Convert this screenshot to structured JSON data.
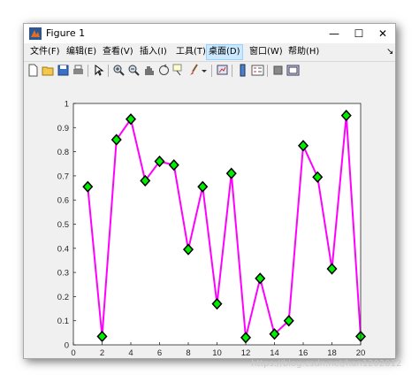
{
  "window": {
    "title": "Figure 1",
    "controls": {
      "minimize": "—",
      "maximize": "☐",
      "close": "✕"
    }
  },
  "menu": {
    "items": [
      {
        "label": "文件(F)"
      },
      {
        "label": "编辑(E)"
      },
      {
        "label": "查看(V)"
      },
      {
        "label": "插入(I)"
      },
      {
        "label": "工具(T)"
      },
      {
        "label": "桌面(D)"
      },
      {
        "label": "窗口(W)"
      },
      {
        "label": "帮助(H)"
      }
    ],
    "active_index": 5,
    "overflow": "↘"
  },
  "toolbar": {
    "icons": [
      "new-figure-icon",
      "open-file-icon",
      "save-icon",
      "print-icon",
      "pointer-icon",
      "zoom-in-icon",
      "zoom-out-icon",
      "pan-icon",
      "rotate-3d-icon",
      "data-cursor-icon",
      "brush-icon",
      "dropdown-arrow-icon",
      "link-plot-icon",
      "colorbar-icon",
      "legend-icon",
      "hide-plot-tools-icon",
      "show-plot-tools-icon"
    ]
  },
  "colors": {
    "line": "#ff00ff",
    "marker_fill": "#00ee00",
    "marker_edge": "#000000",
    "axes_bg": "#ffffff",
    "figure_bg": "#f0f0f0"
  },
  "chart_data": {
    "type": "line",
    "x": [
      1,
      2,
      3,
      4,
      5,
      6,
      7,
      8,
      9,
      10,
      11,
      12,
      13,
      14,
      15,
      16,
      17,
      18,
      19,
      20
    ],
    "series": [
      {
        "values": [
          0.655,
          0.035,
          0.85,
          0.935,
          0.68,
          0.76,
          0.745,
          0.395,
          0.655,
          0.17,
          0.71,
          0.03,
          0.275,
          0.045,
          0.1,
          0.825,
          0.695,
          0.315,
          0.95,
          0.035
        ]
      }
    ],
    "xlim": [
      0,
      20
    ],
    "ylim": [
      0,
      1
    ],
    "xticks": [
      "0",
      "2",
      "4",
      "6",
      "8",
      "10",
      "12",
      "14",
      "16",
      "18",
      "20"
    ],
    "yticks": [
      "0",
      "0.1",
      "0.2",
      "0.3",
      "0.4",
      "0.5",
      "0.6",
      "0.7",
      "0.8",
      "0.9",
      "1"
    ],
    "marker": "diamond",
    "grid": false,
    "title": "",
    "xlabel": "",
    "ylabel": ""
  },
  "watermark": "https://blog.csdn.net/han1202012"
}
